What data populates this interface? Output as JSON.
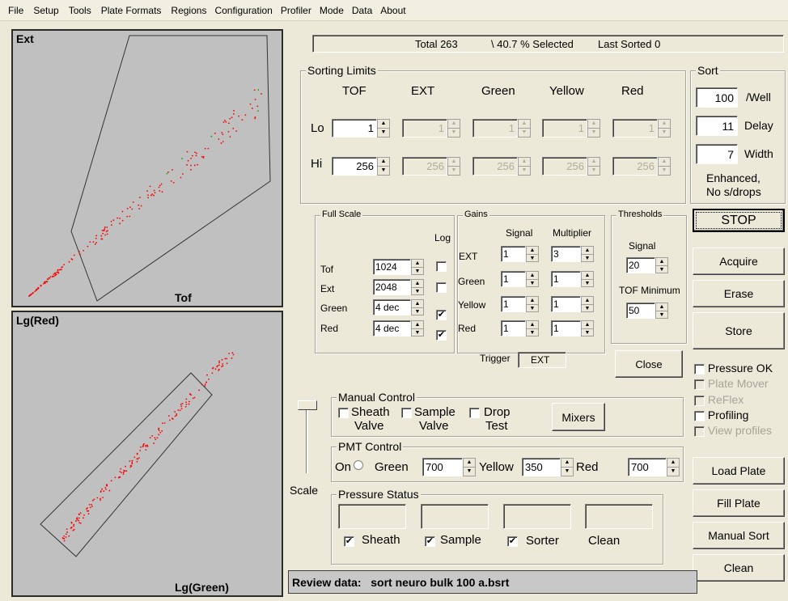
{
  "menu": [
    "File",
    "Setup",
    "Tools",
    "Plate Formats",
    "Regions",
    "Configuration",
    "Profiler",
    "Mode",
    "Data",
    "About"
  ],
  "plot1": {
    "ylabel": "Ext",
    "xlabel": "Tof"
  },
  "plot2": {
    "ylabel": "Lg(Red)",
    "xlabel": "Lg(Green)"
  },
  "status": {
    "total": "Total 263",
    "selected": "\\ 40.7 % Selected",
    "last": "Last Sorted 0"
  },
  "sorting_limits": {
    "title": "Sorting Limits",
    "columns": [
      "TOF",
      "EXT",
      "Green",
      "Yellow",
      "Red"
    ],
    "lo_label": "Lo",
    "hi_label": "Hi",
    "lo": [
      "1",
      "1",
      "1",
      "1",
      "1"
    ],
    "hi": [
      "256",
      "256",
      "256",
      "256",
      "256"
    ]
  },
  "sort": {
    "title": "Sort",
    "well": "100",
    "well_label": "/Well",
    "delay": "11",
    "delay_label": "Delay",
    "width": "7",
    "width_label": "Width",
    "mode1": "Enhanced,",
    "mode2": "No s/drops"
  },
  "full_scale": {
    "title": "Full Scale",
    "log_label": "Log",
    "rows": [
      {
        "label": "Tof",
        "value": "1024",
        "log": ""
      },
      {
        "label": "Ext",
        "value": "2048",
        "log": ""
      },
      {
        "label": "Green",
        "value": "4 dec",
        "log": "✔"
      },
      {
        "label": "Red",
        "value": "4 dec",
        "log": "✔"
      }
    ]
  },
  "gains": {
    "title": "Gains",
    "signal_label": "Signal",
    "multiplier_label": "Multiplier",
    "rows": [
      {
        "label": "EXT",
        "signal": "1",
        "mult": "3"
      },
      {
        "label": "Green",
        "signal": "1",
        "mult": "1"
      },
      {
        "label": "Yellow",
        "signal": "1",
        "mult": "1"
      },
      {
        "label": "Red",
        "signal": "1",
        "mult": "1"
      }
    ],
    "trigger_label": "Trigger",
    "trigger_value": "EXT"
  },
  "thresholds": {
    "title": "Thresholds",
    "signal_label": "Signal",
    "signal": "20",
    "tofmin_label": "TOF Minimum",
    "tofmin": "50"
  },
  "buttons": {
    "stop": "STOP",
    "acquire": "Acquire",
    "erase": "Erase",
    "store": "Store",
    "close": "Close",
    "mixers": "Mixers",
    "load": "Load Plate",
    "fill": "Fill Plate",
    "manual": "Manual Sort",
    "clean": "Clean"
  },
  "checks": {
    "pressure_ok": "Pressure OK",
    "plate_mover": "Plate Mover",
    "reflex": "ReFlex",
    "profiling": "Profiling",
    "view_profiles": "View profiles"
  },
  "manual_control": {
    "title": "Manual Control",
    "sheath1": "Sheath",
    "sheath2": "Valve",
    "sample1": "Sample",
    "sample2": "Valve",
    "drop1": "Drop",
    "drop2": "Test"
  },
  "pmt": {
    "title": "PMT Control",
    "on": "On",
    "green_label": "Green",
    "green": "700",
    "yellow_label": "Yellow",
    "yellow": "350",
    "red_label": "Red",
    "red": "700"
  },
  "scale_label": "Scale",
  "pressure": {
    "title": "Pressure Status",
    "sheath": "Sheath",
    "sample": "Sample",
    "sorter": "Sorter",
    "clean": "Clean"
  },
  "review": "Review data:   sort neuro bulk 100 a.bsrt"
}
